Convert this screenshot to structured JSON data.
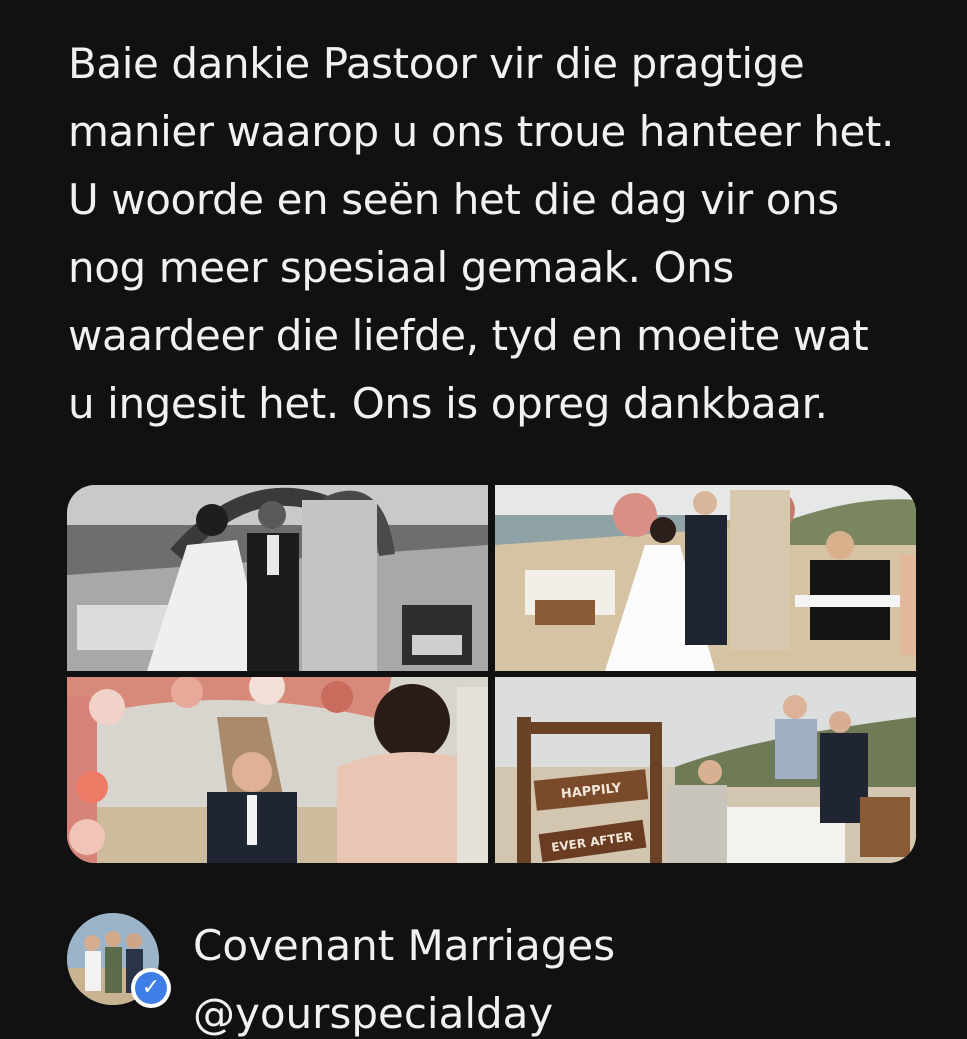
{
  "post": {
    "text": "Baie dankie Pastoor vir die pragtige\nmanier waarop u ons troue hanteer het.\nU woorde en seën het die dag vir ons\nnog meer spesiaal gemaak. Ons\nwaardeer die liefde, tyd en moeite wat\nu ingesit het. Ons is opreg dankbaar."
  },
  "gallery": {
    "photos": [
      {
        "icon": "wedding-ceremony-bw-photo"
      },
      {
        "icon": "wedding-ceremony-beach-photo"
      },
      {
        "icon": "groom-flower-arch-photo"
      },
      {
        "icon": "happily-ever-after-sign-photo"
      }
    ],
    "sign_line_1": "HAPPILY",
    "sign_line_2": "EVER AFTER"
  },
  "author": {
    "name": "Covenant Marriages",
    "handle": "@yourspecialday",
    "verified_color": "#3e7ee6"
  }
}
